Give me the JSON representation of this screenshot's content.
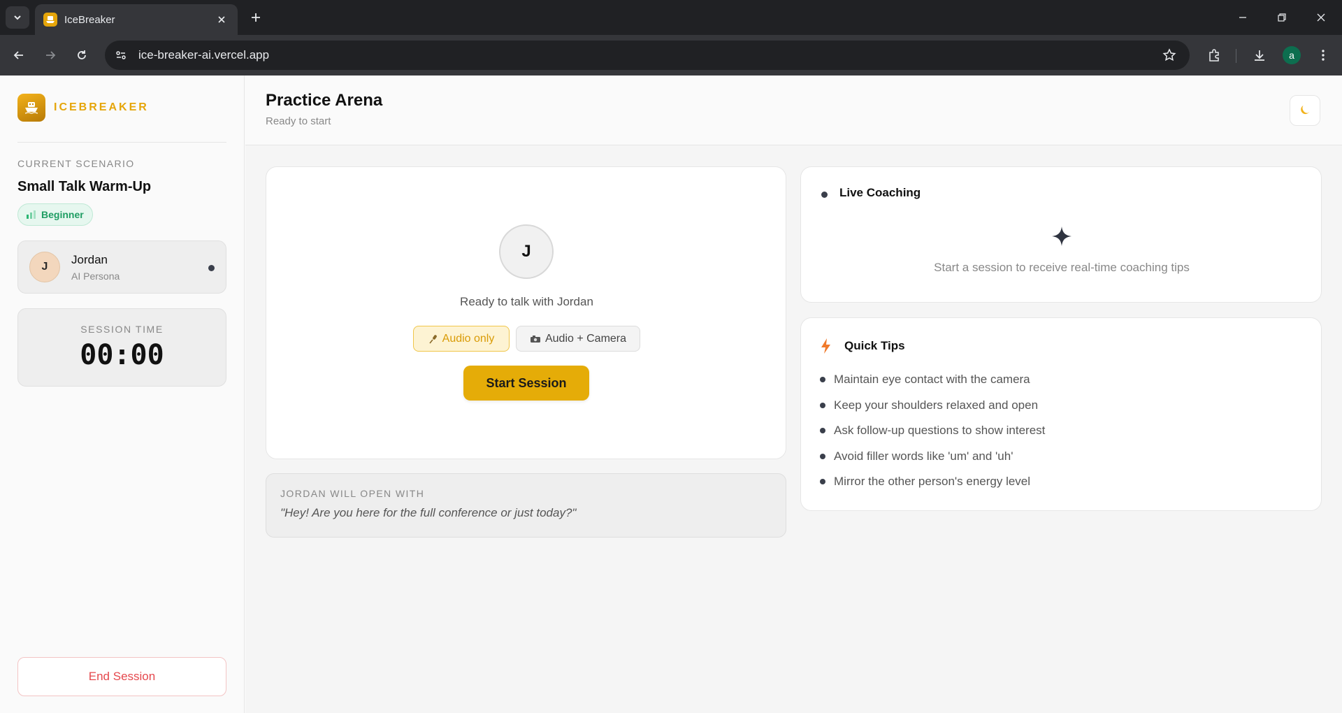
{
  "browser": {
    "tab_title": "IceBreaker",
    "url": "ice-breaker-ai.vercel.app",
    "profile_initial": "a"
  },
  "sidebar": {
    "brand": "ICEBREAKER",
    "current_label": "CURRENT SCENARIO",
    "scenario_title": "Small Talk Warm-Up",
    "level": "Beginner",
    "persona": {
      "initial": "J",
      "name": "Jordan",
      "role": "AI Persona"
    },
    "session_time_label": "SESSION TIME",
    "session_time": "00:00",
    "end_session_label": "End Session"
  },
  "header": {
    "title": "Practice Arena",
    "subtitle": "Ready to start"
  },
  "stage": {
    "avatar_initial": "J",
    "ready_text": "Ready to talk with Jordan",
    "mode_audio_label": "Audio only",
    "mode_camera_label": "Audio + Camera",
    "selected_mode": "Audio only",
    "start_label": "Start Session"
  },
  "opener": {
    "label": "JORDAN WILL OPEN WITH",
    "quote": "\"Hey! Are you here for the full conference or just today?\""
  },
  "coaching": {
    "title": "Live Coaching",
    "hint": "Start a session to receive real-time coaching tips"
  },
  "tips": {
    "title": "Quick Tips",
    "items": [
      "Maintain eye contact with the camera",
      "Keep your shoulders relaxed and open",
      "Ask follow-up questions to show interest",
      "Avoid filler words like 'um' and 'uh'",
      "Mirror the other person's energy level"
    ]
  },
  "colors": {
    "accent": "#e5ac08",
    "success": "#1f9d63",
    "danger": "#e5484d",
    "browser_bg": "#202124"
  },
  "icons": {
    "logo": "boat-icon",
    "theme": "moon-icon",
    "coaching": "sparkle-icon",
    "tips": "bolt-icon",
    "audio": "microphone-icon",
    "camera": "camera-icon"
  }
}
